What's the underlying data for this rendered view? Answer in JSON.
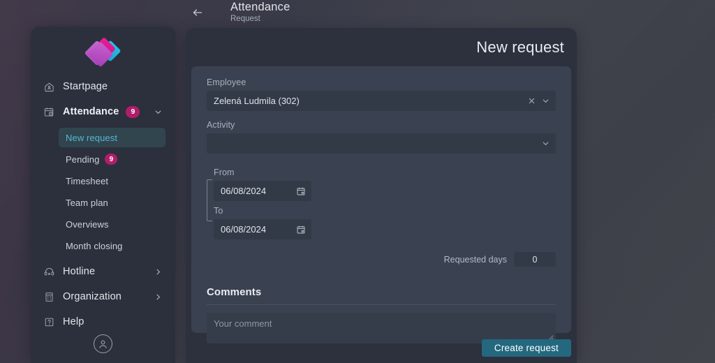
{
  "header": {
    "back_icon": "arrow-left-icon",
    "title": "Attendance",
    "subtitle": "Request"
  },
  "sidebar": {
    "logo_name": "app-logo",
    "items": [
      {
        "label": "Startpage",
        "icon": "home-icon",
        "badge": null,
        "chevron": null
      },
      {
        "label": "Attendance",
        "icon": "calendar-clock-icon",
        "badge": "9",
        "chevron": "chevron-down-icon"
      },
      {
        "label": "Hotline",
        "icon": "headset-icon",
        "badge": null,
        "chevron": "chevron-right-icon"
      },
      {
        "label": "Organization",
        "icon": "building-icon",
        "badge": null,
        "chevron": "chevron-right-icon"
      },
      {
        "label": "Help",
        "icon": "question-box-icon",
        "badge": null,
        "chevron": null
      }
    ],
    "subitems": [
      {
        "label": "New request",
        "badge": null,
        "active": true
      },
      {
        "label": "Pending",
        "badge": "9",
        "active": false
      },
      {
        "label": "Timesheet",
        "badge": null,
        "active": false
      },
      {
        "label": "Team plan",
        "badge": null,
        "active": false
      },
      {
        "label": "Overviews",
        "badge": null,
        "active": false
      },
      {
        "label": "Month closing",
        "badge": null,
        "active": false
      }
    ],
    "avatar_icon": "user-circle-icon"
  },
  "main": {
    "panel_title": "New request",
    "employee": {
      "label": "Employee",
      "value": "Zelená Ludmila (302)",
      "clear_icon": "close-icon",
      "chevron_icon": "chevron-down-icon"
    },
    "activity": {
      "label": "Activity",
      "value": "",
      "chevron_icon": "chevron-down-icon"
    },
    "from": {
      "label": "From",
      "value": "06/08/2024",
      "calendar_icon": "calendar-icon"
    },
    "to": {
      "label": "To",
      "value": "06/08/2024",
      "calendar_icon": "calendar-icon"
    },
    "requested_days": {
      "label": "Requested days",
      "value": "0"
    },
    "comments": {
      "heading": "Comments",
      "placeholder": "Your comment",
      "value": ""
    },
    "submit_label": "Create request"
  },
  "colors": {
    "accent_teal": "#23687e",
    "badge_magenta": "#b01e6a",
    "active_text": "#56b6d4",
    "panel_bg": "#2c313d",
    "card_bg": "#3a4150",
    "sidebar_bg": "#2b303c"
  }
}
